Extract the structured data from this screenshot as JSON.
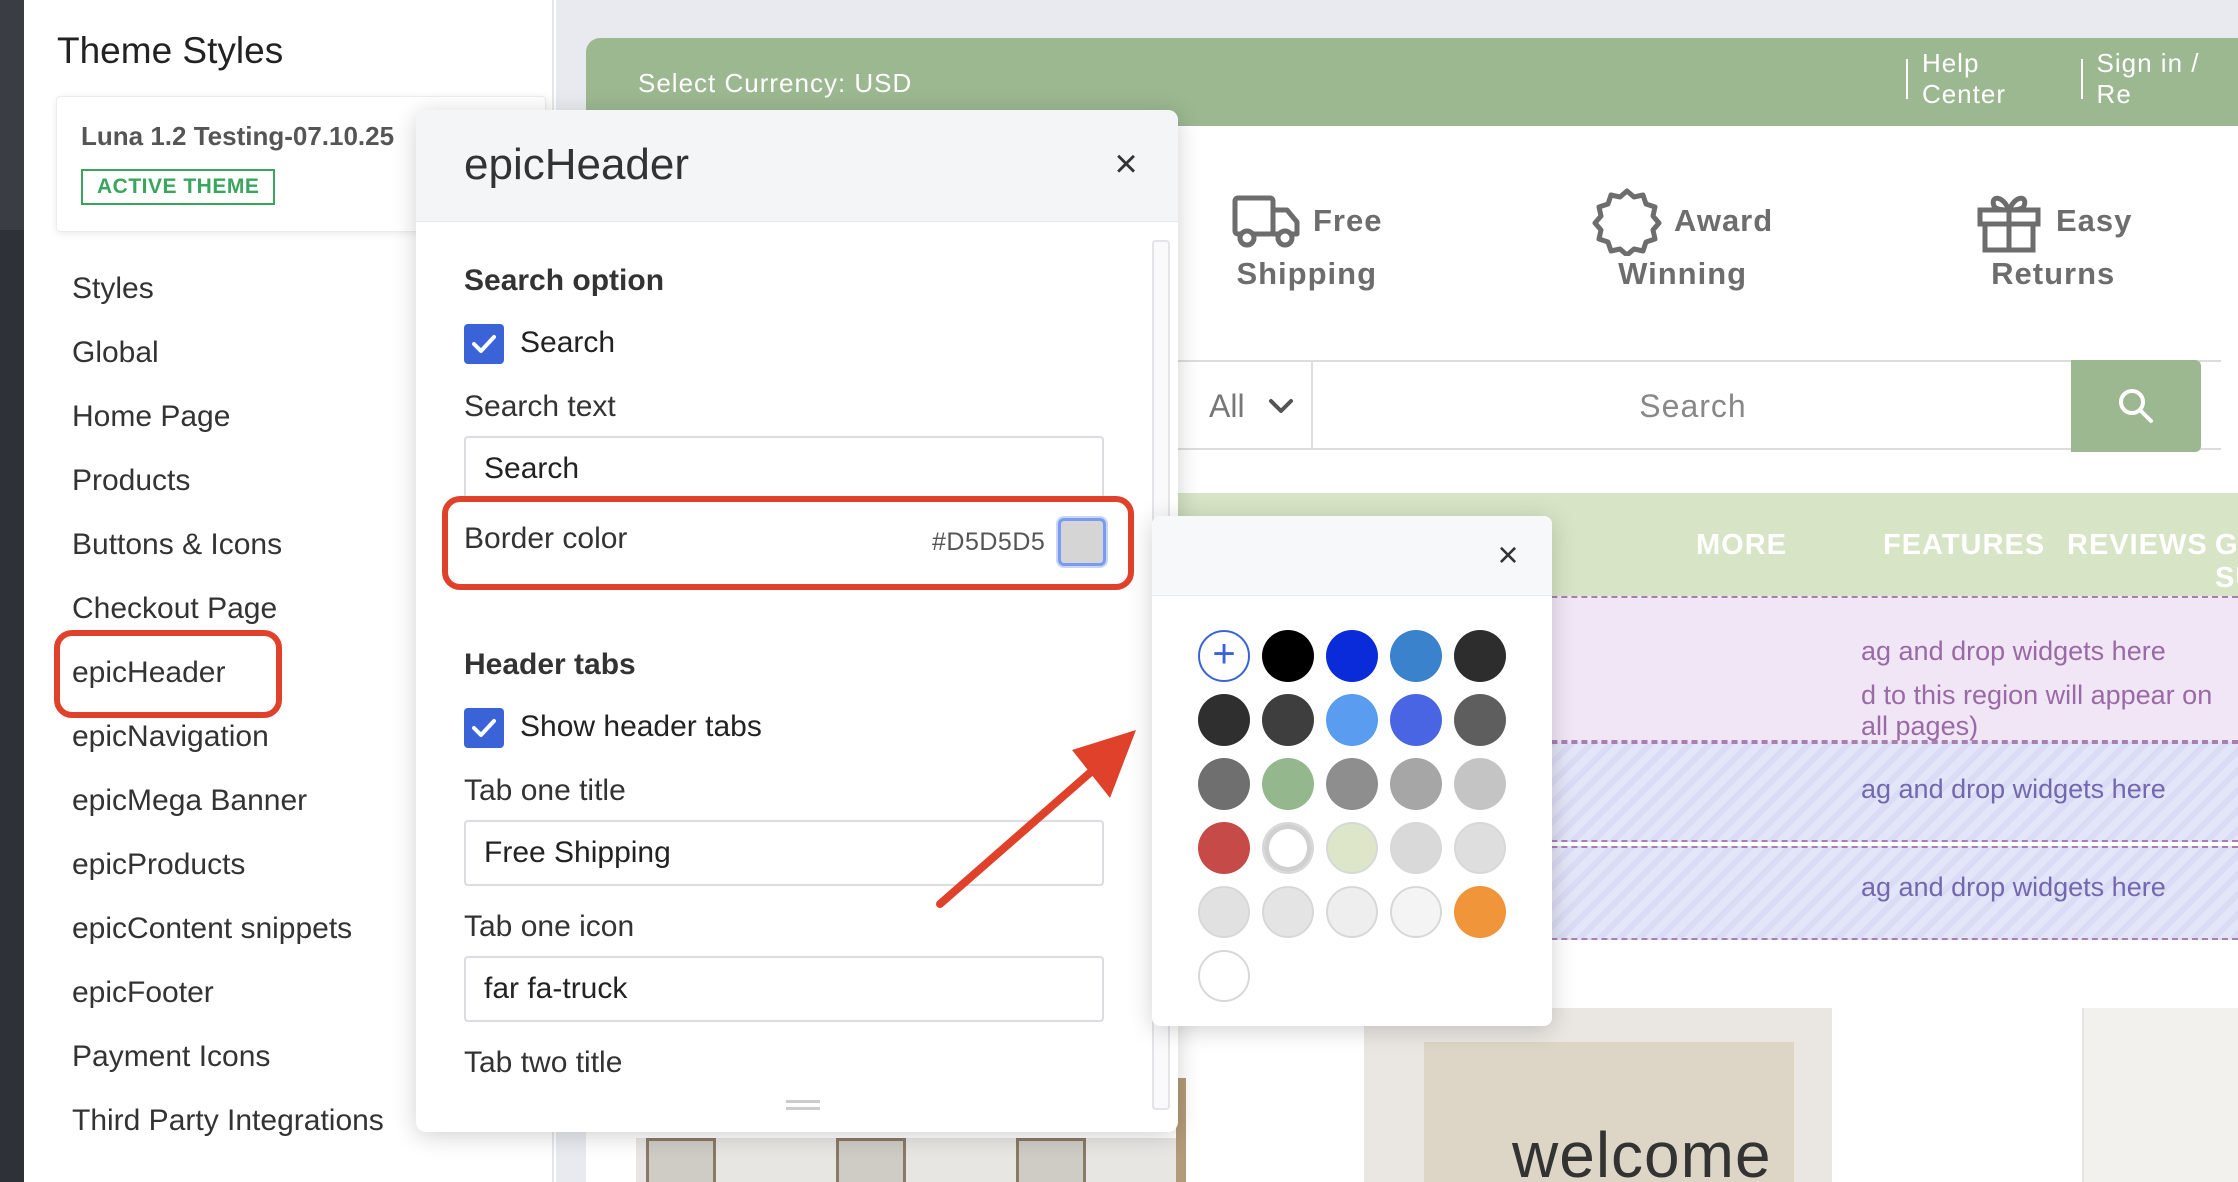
{
  "sidebar": {
    "title": "Theme Styles",
    "theme_name": "Luna 1.2 Testing-07.10.25",
    "active_badge": "ACTIVE THEME",
    "items": [
      {
        "label": "Styles"
      },
      {
        "label": "Global"
      },
      {
        "label": "Home Page"
      },
      {
        "label": "Products"
      },
      {
        "label": "Buttons & Icons"
      },
      {
        "label": "Checkout Page"
      },
      {
        "label": "epicHeader"
      },
      {
        "label": "epicNavigation"
      },
      {
        "label": "epicMega Banner"
      },
      {
        "label": "epicProducts"
      },
      {
        "label": "epicContent snippets"
      },
      {
        "label": "epicFooter"
      },
      {
        "label": "Payment Icons"
      },
      {
        "label": "Third Party Integrations"
      }
    ],
    "selected_item": "epicHeader"
  },
  "panel": {
    "title": "epicHeader",
    "close_glyph": "×",
    "search_section": "Search option",
    "search_checkbox_label": "Search",
    "search_checked": true,
    "search_text_label": "Search text",
    "search_text_value": "Search",
    "border_color_label": "Border color",
    "border_color_value": "#D5D5D5",
    "header_tabs_section": "Header tabs",
    "show_tabs_label": "Show header tabs",
    "show_tabs_checked": true,
    "tab_one_title_label": "Tab one title",
    "tab_one_title_value": "Free Shipping",
    "tab_one_icon_label": "Tab one icon",
    "tab_one_icon_value": "far fa-truck",
    "tab_two_title_label": "Tab two title"
  },
  "color_picker": {
    "close_glyph": "×",
    "add_glyph": "+",
    "swatches": [
      "#000000",
      "#0a2bd9",
      "#3a82cb",
      "#2d2d2d",
      "#2f2f2f",
      "#3e3e3e",
      "#5a9cf0",
      "#4a65e3",
      "#5e5e5e",
      "#6f6f6f",
      "#94b78e",
      "#8e8e8e",
      "#a6a6a6",
      "#c4c4c4",
      "#c64a48",
      "#ffffff",
      "#dde6c8",
      "#d9d9d9",
      "#dedede",
      "#e1e1e1",
      "#e4e4e4",
      "#eeeeee",
      "#f4f4f4",
      "#f0953a",
      "#ffffff"
    ]
  },
  "store": {
    "currency": "Select Currency: USD",
    "help_center": "Help Center",
    "sign_in": "Sign in / Re",
    "tabs": [
      {
        "line1": "Free",
        "line2": "Shipping",
        "icon": "truck-icon"
      },
      {
        "line1": "Award",
        "line2": "Winning",
        "icon": "award-icon"
      },
      {
        "line1": "Easy",
        "line2": "Returns",
        "icon": "gift-icon"
      }
    ],
    "search_category": "All",
    "search_placeholder": "Search",
    "menu": [
      "MORE",
      "FEATURES",
      "REVIEWS",
      "GET SU"
    ],
    "dropzone1_line1": "ag and drop widgets here",
    "dropzone1_line2": "d to this region will appear on all pages)",
    "dropzone2": "ag and drop widgets here",
    "dropzone3": "ag and drop widgets here",
    "hero_text": "welcome"
  },
  "colors": {
    "accent_green": "#9bb890",
    "highlight_red": "#e0412b",
    "checkbox_blue": "#3b63d8",
    "active_green": "#3aa55d"
  }
}
